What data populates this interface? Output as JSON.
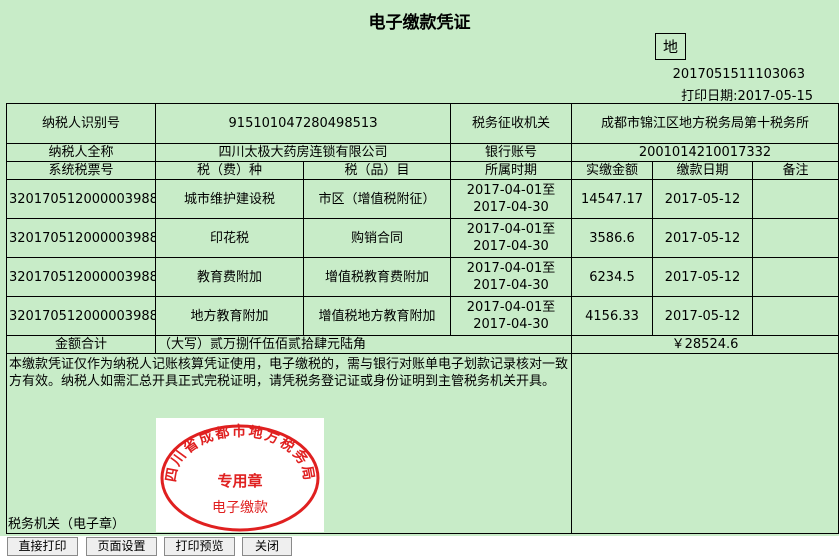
{
  "header": {
    "title": "电子缴款凭证",
    "region_mark": "地",
    "serial_no": "2017051511103063",
    "print_date": "打印日期:2017-05-15"
  },
  "taxpayer": {
    "id_label": "纳税人识别号",
    "id_value": "91510104728049851З",
    "name_label": "纳税人全称",
    "name_value": "四川太极大药房连锁有限公司",
    "authority_label": "税务征收机关",
    "authority_value": "成都市锦江区地方税务局第十税务所",
    "bank_label": "银行账号",
    "bank_value": "2001014210017332"
  },
  "columns": [
    "系统税票号",
    "税（费）种",
    "税（品）目",
    "所属时期",
    "实缴金额",
    "缴款日期",
    "备注"
  ],
  "rows": [
    {
      "ticket": "320170512000003988",
      "tax_type": "城市维护建设税",
      "item": "市区（增值税附征）",
      "period": "2017-04-01至2017-04-30",
      "amount": "14547.17",
      "date": "2017-05-12",
      "note": ""
    },
    {
      "ticket": "320170512000003988",
      "tax_type": "印花税",
      "item": "购销合同",
      "period": "2017-04-01至2017-04-30",
      "amount": "3586.6",
      "date": "2017-05-12",
      "note": ""
    },
    {
      "ticket": "320170512000003988",
      "tax_type": "教育费附加",
      "item": "增值税教育费附加",
      "period": "2017-04-01至2017-04-30",
      "amount": "6234.5",
      "date": "2017-05-12",
      "note": ""
    },
    {
      "ticket": "320170512000003988",
      "tax_type": "地方教育附加",
      "item": "增值税地方教育附加",
      "period": "2017-04-01至2017-04-30",
      "amount": "4156.33",
      "date": "2017-05-12",
      "note": ""
    }
  ],
  "total": {
    "label": "金额合计",
    "words": "（大写）贰万捌仟伍佰贰拾肆元陆角",
    "amount": "￥28524.6"
  },
  "notice": "本缴款凭证仅作为纳税人记账核算凭证使用，电子缴税的，需与银行对账单电子划款记录核对一致方有效。纳税人如需汇总开具正式完税证明，请凭税务登记证或身份证明到主管税务机关开具。",
  "seal": {
    "ring_text": "四川省成都市地方税务局",
    "center_text": "专用章",
    "bottom_text": "电子缴款",
    "color": "#e02020"
  },
  "tax_org_label": "税务机关（电子章）",
  "toolbar": {
    "print_direct": "直接打印",
    "page_setup": "页面设置",
    "print_preview": "打印预览",
    "close": "关闭"
  }
}
